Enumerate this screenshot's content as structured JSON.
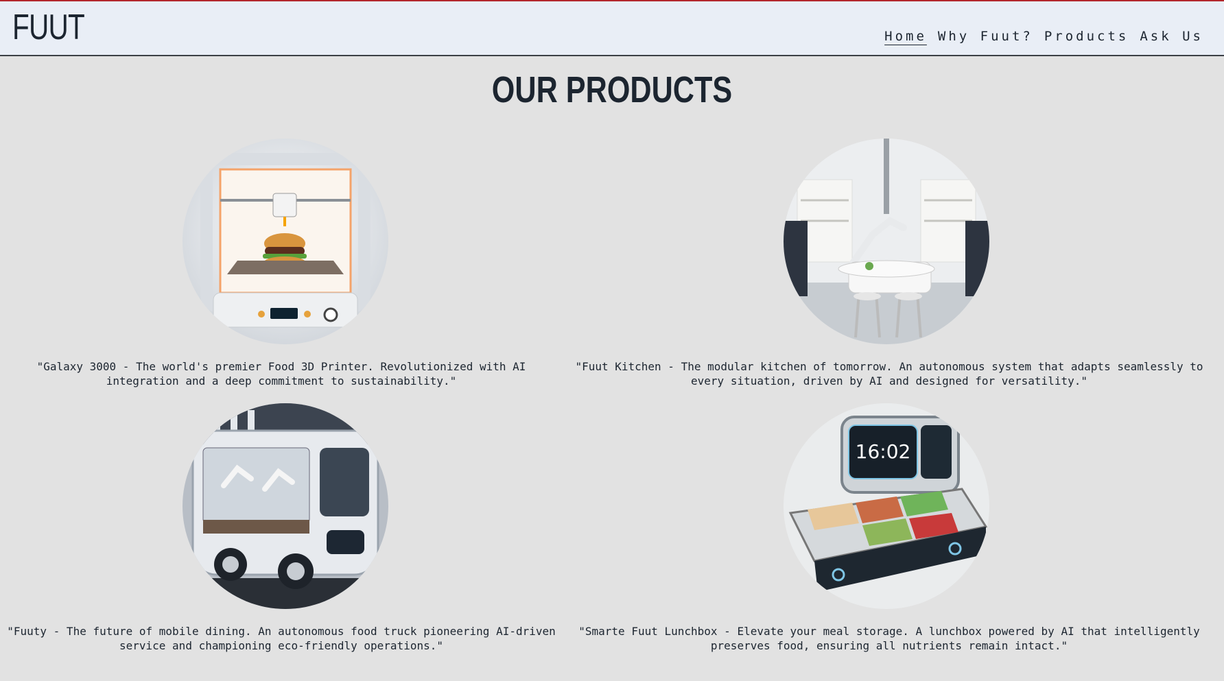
{
  "brand": {
    "logo": "FUUT"
  },
  "nav": {
    "items": [
      {
        "label": "Home",
        "active": true
      },
      {
        "label": "Why Fuut?",
        "active": false
      },
      {
        "label": "Products",
        "active": false
      },
      {
        "label": "Ask Us",
        "active": false
      }
    ]
  },
  "page": {
    "title": "OUR PRODUCTS"
  },
  "products": [
    {
      "image_icon": "food-3d-printer-icon",
      "caption": "\"Galaxy 3000 - The world's premier Food 3D Printer. Revolutionized with AI integration and a deep commitment to sustainability.\""
    },
    {
      "image_icon": "robotic-kitchen-icon",
      "caption": "\"Fuut Kitchen - The modular kitchen of tomorrow. An autonomous system that adapts seamlessly to every situation, driven by AI and designed for versatility.\""
    },
    {
      "image_icon": "food-truck-icon",
      "caption": "\"Fuuty - The future of mobile dining. An autonomous food truck pioneering AI-driven service and championing eco-friendly operations.\""
    },
    {
      "image_icon": "smart-lunchbox-icon",
      "caption": "\"Smarte Fuut Lunchbox - Elevate your meal storage. A lunchbox powered by AI that intelligently preserves food, ensuring all nutrients remain intact.\"",
      "clock": "16:02"
    }
  ],
  "colors": {
    "accent_top": "#b3262c",
    "background": "#e2e2e2",
    "header_bg": "#e9eef6",
    "text": "#1c2530"
  }
}
